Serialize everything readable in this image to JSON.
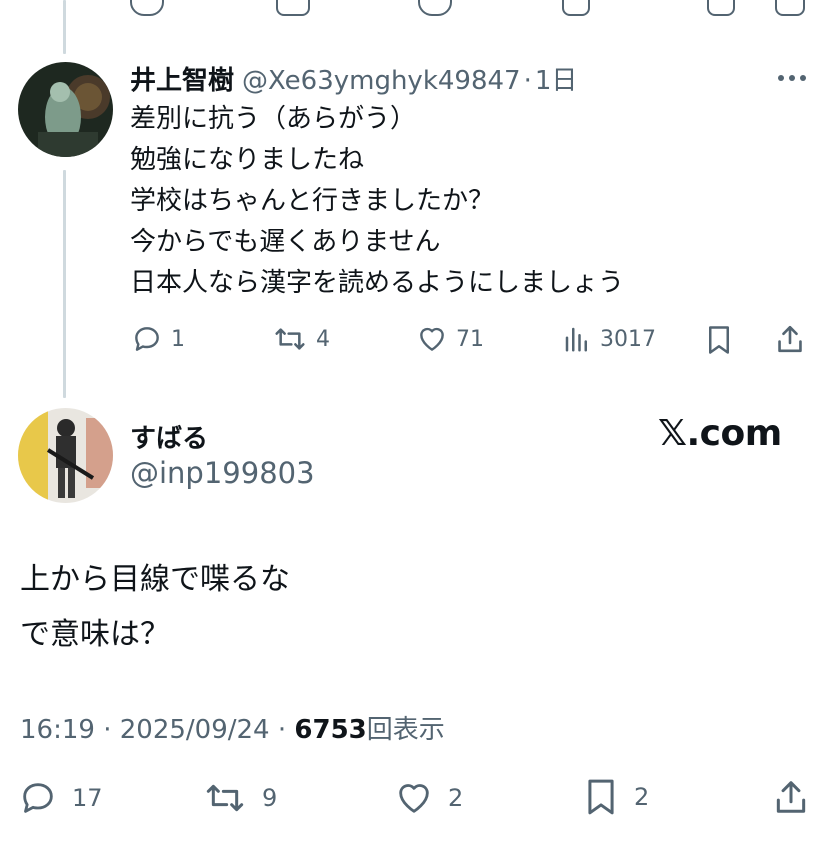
{
  "reply": {
    "name": "井上智樹",
    "handle": "@Xe63ymghyk49847",
    "separator": "·",
    "time": "1日",
    "body": "差別に抗う（あらがう）\n勉強になりましたね\n学校はちゃんと行きましたか？\n今からでも遅くありません\n日本人なら漢字を読めるようにしましょう",
    "actions": {
      "replies": "1",
      "reposts": "4",
      "likes": "71",
      "views": "3017"
    }
  },
  "main": {
    "name": "すばる",
    "handle": "@inp199803",
    "watermark": "𝕏.com",
    "body": "上から目線で喋るな\nで意味は？",
    "time": "16:19",
    "date": "2025/09/24",
    "views": "6753",
    "views_label": "回表示",
    "separator": "·",
    "actions": {
      "replies": "17",
      "reposts": "9",
      "likes": "2",
      "bookmarks": "2"
    }
  },
  "icons": [
    "reply-icon",
    "repost-icon",
    "like-icon",
    "views-icon",
    "bookmark-icon",
    "share-icon",
    "more-icon"
  ],
  "colors": {
    "text": "#0f1419",
    "secondary": "#536471",
    "thread_line": "#cfd9de"
  }
}
